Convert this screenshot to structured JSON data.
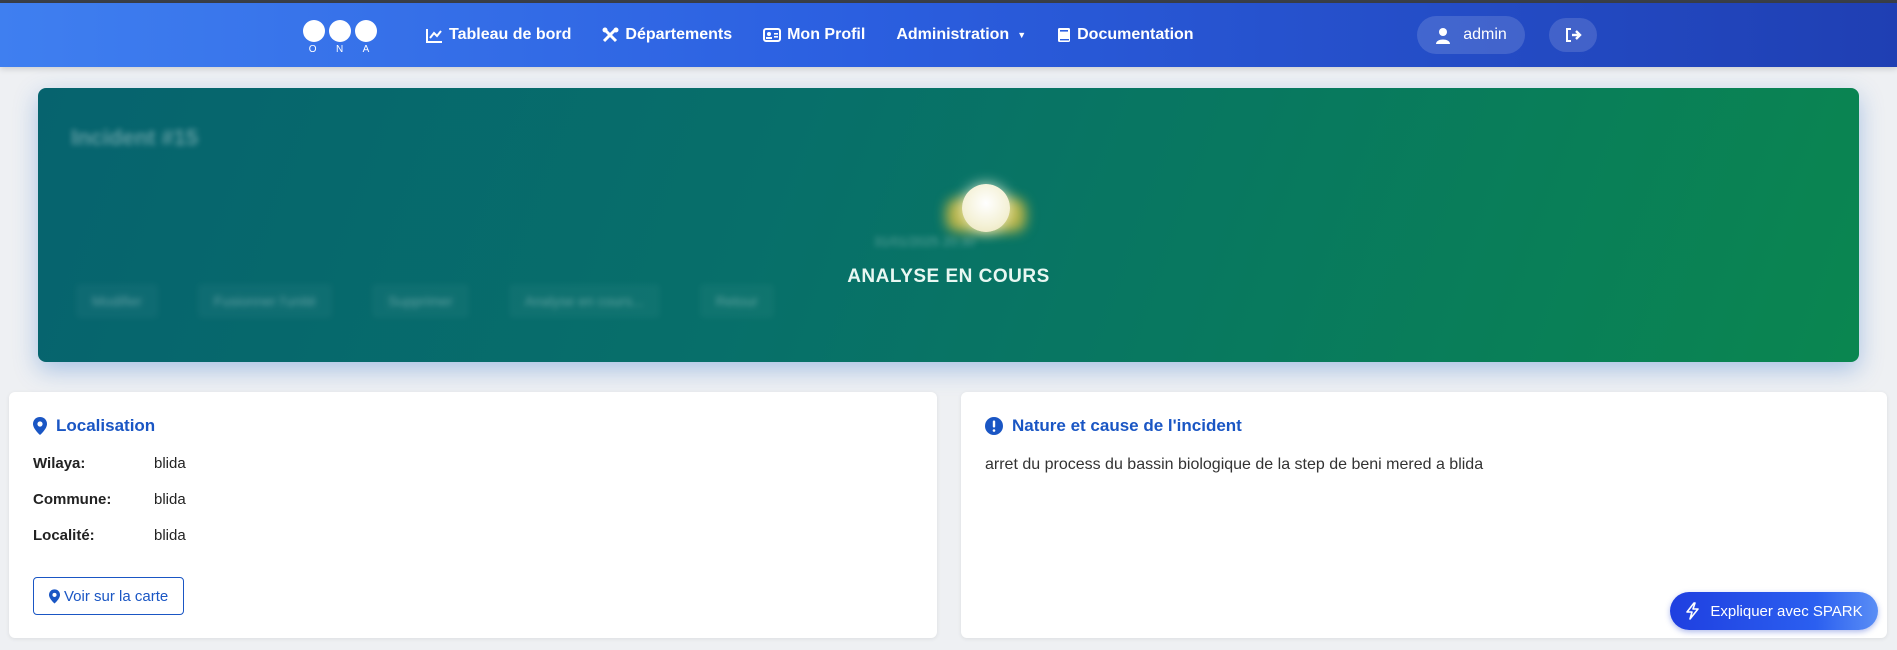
{
  "navbar": {
    "logo_text": [
      "O",
      "N",
      "A"
    ],
    "items": [
      {
        "label": "Tableau de bord",
        "icon": "chart-line-icon"
      },
      {
        "label": "Départements",
        "icon": "tools-icon"
      },
      {
        "label": "Mon Profil",
        "icon": "id-card-icon"
      },
      {
        "label": "Administration",
        "icon": "none",
        "dropdown": true
      },
      {
        "label": "Documentation",
        "icon": "book-icon"
      }
    ],
    "user": {
      "name": "admin",
      "icon": "user-icon"
    },
    "logout_icon": "sign-out-icon"
  },
  "hero": {
    "title": "Incident #15",
    "date": "31/01/2025 20:30",
    "status": "ANALYSE EN COURS",
    "actions": [
      "Modifier",
      "Fusionner l'unité",
      "Supprimer",
      "Analyse en cours...",
      "Retour"
    ],
    "colors": {
      "gradient_start": "#06636e",
      "gradient_end": "#0a8650"
    }
  },
  "localisation": {
    "title": "Localisation",
    "fields": [
      {
        "label": "Wilaya:",
        "value": "blida"
      },
      {
        "label": "Commune:",
        "value": "blida"
      },
      {
        "label": "Localité:",
        "value": "blida"
      }
    ],
    "map_button": "Voir sur la carte"
  },
  "nature": {
    "title": "Nature et cause de l'incident",
    "text": "arret du process du bassin biologique de la step de beni mered a blida"
  },
  "spark_button": "Expliquer avec SPARK",
  "colors": {
    "accent": "#1a56c4",
    "navbar_start": "#3f7ff0",
    "navbar_end": "#1f3fb3"
  }
}
